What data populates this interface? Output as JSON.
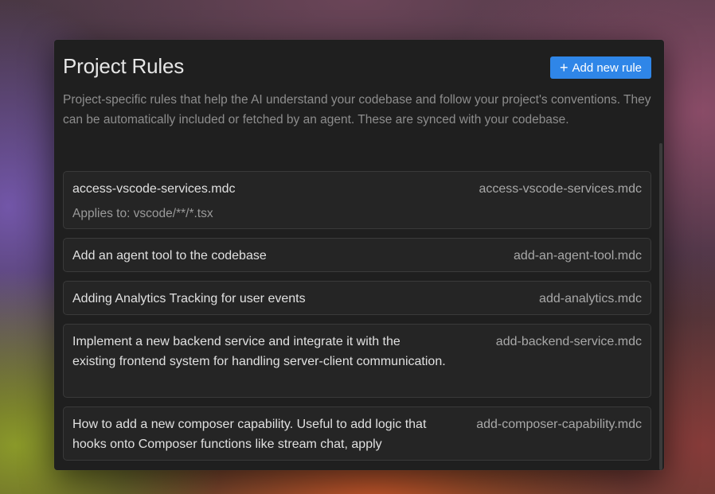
{
  "panel": {
    "title": "Project Rules",
    "add_button_label": "Add new rule",
    "add_button_icon": "plus-icon",
    "description": "Project-specific rules that help the AI understand your codebase and follow your project's conventions. They can be automatically included or fetched by an agent. These are synced with your codebase."
  },
  "rules": [
    {
      "name": "access-vscode-services.mdc",
      "applies": "Applies to: vscode/**/*.tsx",
      "file": "access-vscode-services.mdc"
    },
    {
      "name": "Add an agent tool to the codebase",
      "file": "add-an-agent-tool.mdc"
    },
    {
      "name": "Adding Analytics Tracking for user events",
      "file": "add-analytics.mdc"
    },
    {
      "name": "Implement a new backend service and integrate it with the existing frontend system for handling server-client communication.",
      "file": "add-backend-service.mdc"
    },
    {
      "name": "How to add a new composer capability. Useful to add logic that hooks onto Composer functions like stream chat, apply",
      "file": "add-composer-capability.mdc"
    }
  ],
  "colors": {
    "accent": "#2f86e8",
    "panel_bg": "#1f1f1f",
    "card_bg": "#252525"
  }
}
